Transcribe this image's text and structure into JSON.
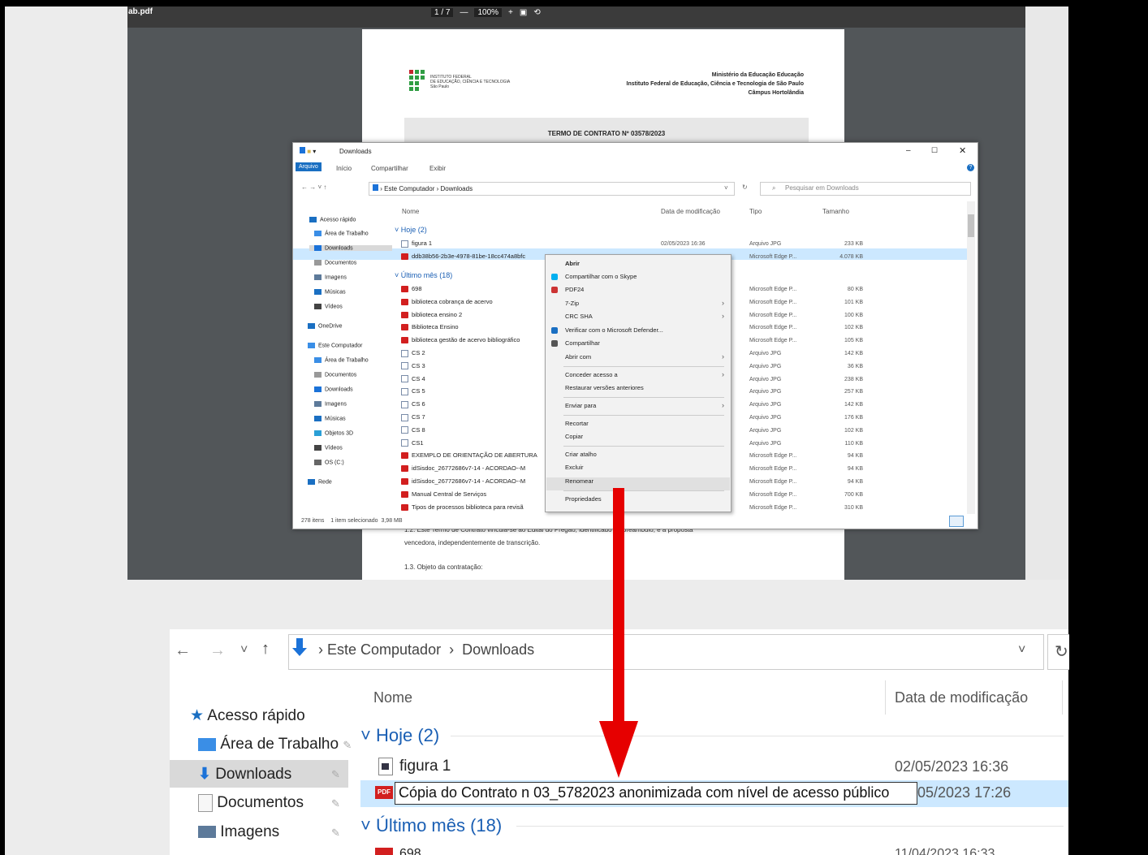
{
  "pdf_viewer": {
    "file_name": "ab.pdf",
    "page_indicator": "1 / 7",
    "zoom": "100%",
    "doc": {
      "institute_logo_text": [
        "INSTITUTO FEDERAL",
        "DE EDUCAÇÃO, CIÊNCIA E TECNOLOGIA",
        "São Paulo"
      ],
      "ministry": [
        "Ministério da Educação Educação",
        "Instituto Federal de Educação, Ciência e Tecnologia de São Paulo",
        "Câmpus Hortolândia"
      ],
      "title": "TERMO DE CONTRATO Nº 03578/2023",
      "line1": "1.2. Este Termo de Contrato vincula-se ao Edital do Pregão, identificado no preâmbulo, e à proposta",
      "line2": "vencedora, independentemente de transcrição.",
      "line3": "1.3. Objeto da contratação:"
    }
  },
  "explorer_small": {
    "title": "Downloads",
    "ribbon_tabs": [
      "Arquivo",
      "Início",
      "Compartilhar",
      "Exibir"
    ],
    "address": [
      "Este Computador",
      "Downloads"
    ],
    "search_placeholder": "Pesquisar em Downloads",
    "columns": {
      "name": "Nome",
      "date": "Data de modificação",
      "type": "Tipo",
      "size": "Tamanho"
    },
    "sidebar": [
      "Acesso rápido",
      "Área de Trabalho",
      "Downloads",
      "Documentos",
      "Imagens",
      "Músicas",
      "Vídeos",
      "OneDrive",
      "Este Computador",
      "Área de Trabalho",
      "Documentos",
      "Downloads",
      "Imagens",
      "Músicas",
      "Objetos 3D",
      "Vídeos",
      "OS (C:)",
      "Rede"
    ],
    "group_today": "Hoje (2)",
    "group_month": "Último mês (18)",
    "today_files": [
      {
        "name": "figura 1",
        "date": "02/05/2023 16:36",
        "type": "Arquivo JPG",
        "size": "233 KB",
        "icon": "jpg"
      },
      {
        "name": "ddb38b56-2b3e-4978-81be-18cc474a8bfc",
        "date": "",
        "type": "Microsoft Edge P...",
        "size": "4.078 KB",
        "icon": "pdf"
      }
    ],
    "month_files": [
      {
        "name": "698",
        "type": "Microsoft Edge P...",
        "size": "80 KB",
        "icon": "pdf"
      },
      {
        "name": "biblioteca cobrança de acervo",
        "type": "Microsoft Edge P...",
        "size": "101 KB",
        "icon": "pdf"
      },
      {
        "name": "biblioteca ensino 2",
        "type": "Microsoft Edge P...",
        "size": "100 KB",
        "icon": "pdf"
      },
      {
        "name": "Biblioteca Ensino",
        "type": "Microsoft Edge P...",
        "size": "102 KB",
        "icon": "pdf"
      },
      {
        "name": "biblioteca gestão de acervo bibliográfico",
        "type": "Microsoft Edge P...",
        "size": "105 KB",
        "icon": "pdf"
      },
      {
        "name": "CS 2",
        "type": "Arquivo JPG",
        "size": "142 KB",
        "icon": "jpg"
      },
      {
        "name": "CS 3",
        "type": "Arquivo JPG",
        "size": "36 KB",
        "icon": "jpg"
      },
      {
        "name": "CS 4",
        "type": "Arquivo JPG",
        "size": "238 KB",
        "icon": "jpg"
      },
      {
        "name": "CS 5",
        "type": "Arquivo JPG",
        "size": "257 KB",
        "icon": "jpg"
      },
      {
        "name": "CS 6",
        "type": "Arquivo JPG",
        "size": "142 KB",
        "icon": "jpg"
      },
      {
        "name": "CS 7",
        "type": "Arquivo JPG",
        "size": "176 KB",
        "icon": "jpg"
      },
      {
        "name": "CS 8",
        "type": "Arquivo JPG",
        "size": "102 KB",
        "icon": "jpg"
      },
      {
        "name": "CS1",
        "type": "Arquivo JPG",
        "size": "110 KB",
        "icon": "jpg"
      },
      {
        "name": "EXEMPLO DE ORIENTAÇÃO DE ABERTURA",
        "type": "Microsoft Edge P...",
        "size": "94 KB",
        "icon": "pdf"
      },
      {
        "name": "idSisdoc_26772686v7-14 - ACORDAO--M",
        "type": "Microsoft Edge P...",
        "size": "94 KB",
        "icon": "pdf"
      },
      {
        "name": "idSisdoc_26772686v7-14 - ACORDAO--M",
        "type": "Microsoft Edge P...",
        "size": "94 KB",
        "icon": "pdf"
      },
      {
        "name": "Manual Central de Serviços",
        "type": "Microsoft Edge P...",
        "size": "700 KB",
        "icon": "pdf"
      },
      {
        "name": "Tipos de processos biblioteca para revisã",
        "type": "Microsoft Edge P...",
        "size": "310 KB",
        "icon": "pdf"
      }
    ],
    "status": {
      "count": "278 itens",
      "selected": "1 item selecionado",
      "size": "3,98 MB"
    }
  },
  "context_menu": [
    {
      "label": "Abrir",
      "bold": true
    },
    {
      "label": "Compartilhar com o Skype",
      "icon": "skype"
    },
    {
      "label": "PDF24",
      "icon": "pdf24"
    },
    {
      "label": "7-Zip",
      "sub": true
    },
    {
      "label": "CRC SHA",
      "sub": true
    },
    {
      "label": "Verificar com o Microsoft Defender...",
      "icon": "defender"
    },
    {
      "label": "Compartilhar",
      "icon": "share"
    },
    {
      "label": "Abrir com",
      "sub": true
    },
    {
      "label": "Conceder acesso a",
      "sub": true
    },
    {
      "label": "Restaurar versões anteriores"
    },
    {
      "label": "Enviar para",
      "sub": true
    },
    {
      "label": "Recortar"
    },
    {
      "label": "Copiar"
    },
    {
      "label": "Criar atalho"
    },
    {
      "label": "Excluir"
    },
    {
      "label": "Renomear"
    },
    {
      "label": "Propriedades"
    }
  ],
  "explorer_big": {
    "address": [
      "Este Computador",
      "Downloads"
    ],
    "col_name": "Nome",
    "col_date": "Data de modificação",
    "sidebar": [
      "Acesso rápido",
      "Área de Trabalho",
      "Downloads",
      "Documentos",
      "Imagens"
    ],
    "group_today": "Hoje (2)",
    "group_month": "Último mês (18)",
    "file1_name": "figura 1",
    "file1_date": "02/05/2023 16:36",
    "rename_value": "Cópia do Contrato n 03_5782023 anonimizada com nível de acesso público",
    "file2_date": "05/2023 17:26",
    "partial_name": "698",
    "partial_date": "11/04/2023 16:33"
  }
}
